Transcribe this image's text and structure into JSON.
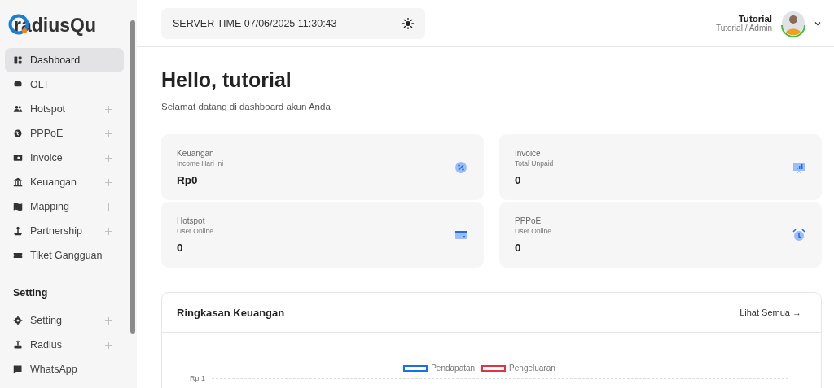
{
  "brand": "radiusQu",
  "sidebar": {
    "items": [
      {
        "label": "Dashboard",
        "selected": true,
        "expandable": false
      },
      {
        "label": "OLT",
        "selected": false,
        "expandable": false
      },
      {
        "label": "Hotspot",
        "selected": false,
        "expandable": true
      },
      {
        "label": "PPPoE",
        "selected": false,
        "expandable": true
      },
      {
        "label": "Invoice",
        "selected": false,
        "expandable": true
      },
      {
        "label": "Keuangan",
        "selected": false,
        "expandable": true
      },
      {
        "label": "Mapping",
        "selected": false,
        "expandable": true
      },
      {
        "label": "Partnership",
        "selected": false,
        "expandable": true
      },
      {
        "label": "Tiket Gangguan",
        "selected": false,
        "expandable": false
      }
    ],
    "section": "Setting",
    "section_items": [
      {
        "label": "Setting",
        "selected": false,
        "expandable": true
      },
      {
        "label": "Radius",
        "selected": false,
        "expandable": true
      },
      {
        "label": "WhatsApp",
        "selected": false,
        "expandable": false
      }
    ]
  },
  "header": {
    "server_time": "SERVER TIME 07/06/2025 11:30:43",
    "user_name": "Tutorial",
    "user_role": "Tutorial / Admin"
  },
  "greeting": {
    "title": "Hello, tutorial",
    "subtitle": "Selamat datang di dashboard akun Anda"
  },
  "stats": [
    {
      "title": "Keuangan",
      "subtitle": "Income Hari Ini",
      "value": "Rp0"
    },
    {
      "title": "Invoice",
      "subtitle": "Total Unpaid",
      "value": "0"
    },
    {
      "title": "Hotspot",
      "subtitle": "User Online",
      "value": "0"
    },
    {
      "title": "PPPoE",
      "subtitle": "User Online",
      "value": "0"
    }
  ],
  "summary": {
    "title": "Ringkasan Keuangan",
    "link": "Lihat Semua",
    "arrow": "→",
    "legend": [
      {
        "label": "Pendapatan",
        "color": "#1a6cf0"
      },
      {
        "label": "Pengeluaran",
        "color": "#e03444"
      }
    ],
    "y_tick": "Rp 1"
  }
}
